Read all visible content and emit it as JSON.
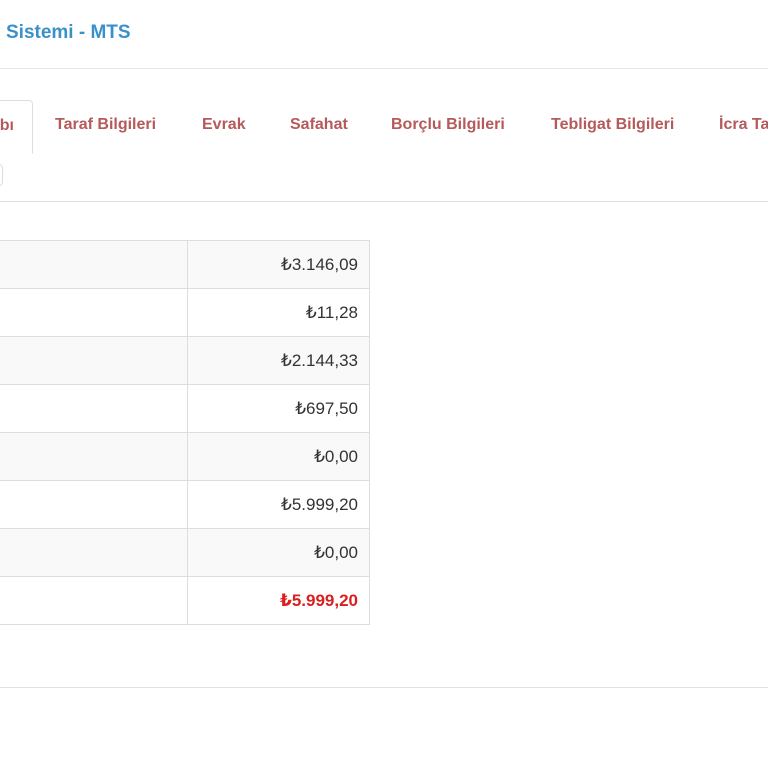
{
  "header": {
    "title": "Sistemi - MTS"
  },
  "tabs": {
    "active_label": "bı",
    "items": [
      {
        "key": "taraf",
        "label": "Taraf Bilgileri"
      },
      {
        "key": "evrak",
        "label": "Evrak"
      },
      {
        "key": "safahat",
        "label": "Safahat"
      },
      {
        "key": "borclu",
        "label": "Borçlu Bilgileri"
      },
      {
        "key": "tebligat",
        "label": "Tebligat Bilgileri"
      },
      {
        "key": "icra",
        "label": "İcra Ta"
      }
    ]
  },
  "summary": {
    "rows": [
      {
        "label": "",
        "value": "₺3.146,09"
      },
      {
        "label": "",
        "value": "₺11,28"
      },
      {
        "label": "",
        "value": "₺2.144,33"
      },
      {
        "label": "",
        "value": "₺697,50"
      },
      {
        "label": "",
        "value": "₺0,00"
      },
      {
        "label": "",
        "value": "₺5.999,20"
      },
      {
        "label": "",
        "value": "₺0,00"
      },
      {
        "label": "",
        "value": "₺5.999,20"
      }
    ]
  },
  "colors": {
    "title": "#3a91c9",
    "tab_text": "#b55a5a",
    "total_value": "#d9201f"
  }
}
